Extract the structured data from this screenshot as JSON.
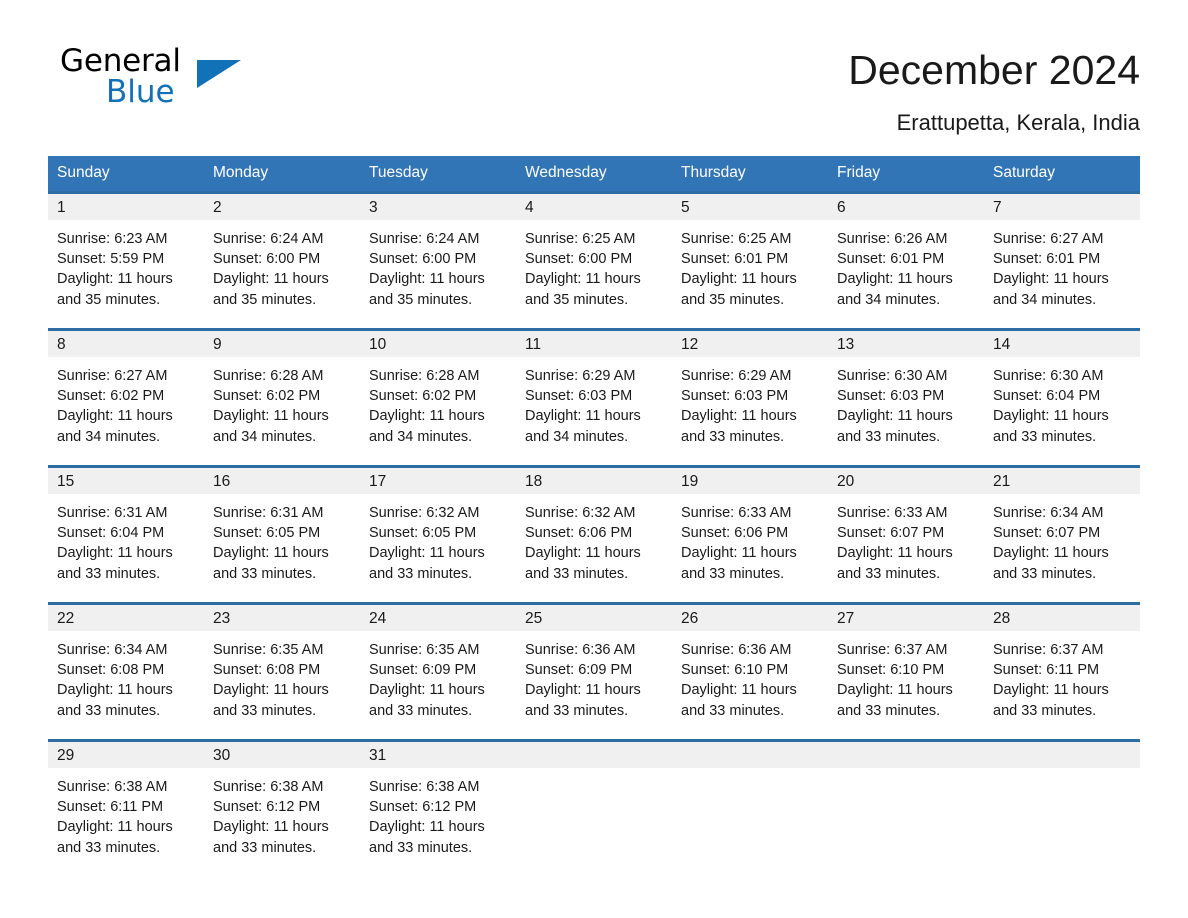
{
  "brand": {
    "line1": "General",
    "line2": "Blue",
    "triangle_color": "#1172b8"
  },
  "header": {
    "title": "December 2024",
    "location": "Erattupetta, Kerala, India"
  },
  "theme": {
    "header_bg": "#3275b6",
    "row_rule": "#2e6da4",
    "daynum_bg": "#f0f0f0",
    "text": "#1a1a1a"
  },
  "weekday_headers": [
    "Sunday",
    "Monday",
    "Tuesday",
    "Wednesday",
    "Thursday",
    "Friday",
    "Saturday"
  ],
  "labels": {
    "sunrise_prefix": "Sunrise:",
    "sunset_prefix": "Sunset:",
    "daylight_prefix": "Daylight:"
  },
  "weeks": [
    [
      {
        "day": "1",
        "sunrise": "Sunrise: 6:23 AM",
        "sunset": "Sunset: 5:59 PM",
        "daylight_line1": "Daylight: 11 hours",
        "daylight_line2": "and 35 minutes."
      },
      {
        "day": "2",
        "sunrise": "Sunrise: 6:24 AM",
        "sunset": "Sunset: 6:00 PM",
        "daylight_line1": "Daylight: 11 hours",
        "daylight_line2": "and 35 minutes."
      },
      {
        "day": "3",
        "sunrise": "Sunrise: 6:24 AM",
        "sunset": "Sunset: 6:00 PM",
        "daylight_line1": "Daylight: 11 hours",
        "daylight_line2": "and 35 minutes."
      },
      {
        "day": "4",
        "sunrise": "Sunrise: 6:25 AM",
        "sunset": "Sunset: 6:00 PM",
        "daylight_line1": "Daylight: 11 hours",
        "daylight_line2": "and 35 minutes."
      },
      {
        "day": "5",
        "sunrise": "Sunrise: 6:25 AM",
        "sunset": "Sunset: 6:01 PM",
        "daylight_line1": "Daylight: 11 hours",
        "daylight_line2": "and 35 minutes."
      },
      {
        "day": "6",
        "sunrise": "Sunrise: 6:26 AM",
        "sunset": "Sunset: 6:01 PM",
        "daylight_line1": "Daylight: 11 hours",
        "daylight_line2": "and 34 minutes."
      },
      {
        "day": "7",
        "sunrise": "Sunrise: 6:27 AM",
        "sunset": "Sunset: 6:01 PM",
        "daylight_line1": "Daylight: 11 hours",
        "daylight_line2": "and 34 minutes."
      }
    ],
    [
      {
        "day": "8",
        "sunrise": "Sunrise: 6:27 AM",
        "sunset": "Sunset: 6:02 PM",
        "daylight_line1": "Daylight: 11 hours",
        "daylight_line2": "and 34 minutes."
      },
      {
        "day": "9",
        "sunrise": "Sunrise: 6:28 AM",
        "sunset": "Sunset: 6:02 PM",
        "daylight_line1": "Daylight: 11 hours",
        "daylight_line2": "and 34 minutes."
      },
      {
        "day": "10",
        "sunrise": "Sunrise: 6:28 AM",
        "sunset": "Sunset: 6:02 PM",
        "daylight_line1": "Daylight: 11 hours",
        "daylight_line2": "and 34 minutes."
      },
      {
        "day": "11",
        "sunrise": "Sunrise: 6:29 AM",
        "sunset": "Sunset: 6:03 PM",
        "daylight_line1": "Daylight: 11 hours",
        "daylight_line2": "and 34 minutes."
      },
      {
        "day": "12",
        "sunrise": "Sunrise: 6:29 AM",
        "sunset": "Sunset: 6:03 PM",
        "daylight_line1": "Daylight: 11 hours",
        "daylight_line2": "and 33 minutes."
      },
      {
        "day": "13",
        "sunrise": "Sunrise: 6:30 AM",
        "sunset": "Sunset: 6:03 PM",
        "daylight_line1": "Daylight: 11 hours",
        "daylight_line2": "and 33 minutes."
      },
      {
        "day": "14",
        "sunrise": "Sunrise: 6:30 AM",
        "sunset": "Sunset: 6:04 PM",
        "daylight_line1": "Daylight: 11 hours",
        "daylight_line2": "and 33 minutes."
      }
    ],
    [
      {
        "day": "15",
        "sunrise": "Sunrise: 6:31 AM",
        "sunset": "Sunset: 6:04 PM",
        "daylight_line1": "Daylight: 11 hours",
        "daylight_line2": "and 33 minutes."
      },
      {
        "day": "16",
        "sunrise": "Sunrise: 6:31 AM",
        "sunset": "Sunset: 6:05 PM",
        "daylight_line1": "Daylight: 11 hours",
        "daylight_line2": "and 33 minutes."
      },
      {
        "day": "17",
        "sunrise": "Sunrise: 6:32 AM",
        "sunset": "Sunset: 6:05 PM",
        "daylight_line1": "Daylight: 11 hours",
        "daylight_line2": "and 33 minutes."
      },
      {
        "day": "18",
        "sunrise": "Sunrise: 6:32 AM",
        "sunset": "Sunset: 6:06 PM",
        "daylight_line1": "Daylight: 11 hours",
        "daylight_line2": "and 33 minutes."
      },
      {
        "day": "19",
        "sunrise": "Sunrise: 6:33 AM",
        "sunset": "Sunset: 6:06 PM",
        "daylight_line1": "Daylight: 11 hours",
        "daylight_line2": "and 33 minutes."
      },
      {
        "day": "20",
        "sunrise": "Sunrise: 6:33 AM",
        "sunset": "Sunset: 6:07 PM",
        "daylight_line1": "Daylight: 11 hours",
        "daylight_line2": "and 33 minutes."
      },
      {
        "day": "21",
        "sunrise": "Sunrise: 6:34 AM",
        "sunset": "Sunset: 6:07 PM",
        "daylight_line1": "Daylight: 11 hours",
        "daylight_line2": "and 33 minutes."
      }
    ],
    [
      {
        "day": "22",
        "sunrise": "Sunrise: 6:34 AM",
        "sunset": "Sunset: 6:08 PM",
        "daylight_line1": "Daylight: 11 hours",
        "daylight_line2": "and 33 minutes."
      },
      {
        "day": "23",
        "sunrise": "Sunrise: 6:35 AM",
        "sunset": "Sunset: 6:08 PM",
        "daylight_line1": "Daylight: 11 hours",
        "daylight_line2": "and 33 minutes."
      },
      {
        "day": "24",
        "sunrise": "Sunrise: 6:35 AM",
        "sunset": "Sunset: 6:09 PM",
        "daylight_line1": "Daylight: 11 hours",
        "daylight_line2": "and 33 minutes."
      },
      {
        "day": "25",
        "sunrise": "Sunrise: 6:36 AM",
        "sunset": "Sunset: 6:09 PM",
        "daylight_line1": "Daylight: 11 hours",
        "daylight_line2": "and 33 minutes."
      },
      {
        "day": "26",
        "sunrise": "Sunrise: 6:36 AM",
        "sunset": "Sunset: 6:10 PM",
        "daylight_line1": "Daylight: 11 hours",
        "daylight_line2": "and 33 minutes."
      },
      {
        "day": "27",
        "sunrise": "Sunrise: 6:37 AM",
        "sunset": "Sunset: 6:10 PM",
        "daylight_line1": "Daylight: 11 hours",
        "daylight_line2": "and 33 minutes."
      },
      {
        "day": "28",
        "sunrise": "Sunrise: 6:37 AM",
        "sunset": "Sunset: 6:11 PM",
        "daylight_line1": "Daylight: 11 hours",
        "daylight_line2": "and 33 minutes."
      }
    ],
    [
      {
        "day": "29",
        "sunrise": "Sunrise: 6:38 AM",
        "sunset": "Sunset: 6:11 PM",
        "daylight_line1": "Daylight: 11 hours",
        "daylight_line2": "and 33 minutes."
      },
      {
        "day": "30",
        "sunrise": "Sunrise: 6:38 AM",
        "sunset": "Sunset: 6:12 PM",
        "daylight_line1": "Daylight: 11 hours",
        "daylight_line2": "and 33 minutes."
      },
      {
        "day": "31",
        "sunrise": "Sunrise: 6:38 AM",
        "sunset": "Sunset: 6:12 PM",
        "daylight_line1": "Daylight: 11 hours",
        "daylight_line2": "and 33 minutes."
      },
      {
        "day": "",
        "sunrise": "",
        "sunset": "",
        "daylight_line1": "",
        "daylight_line2": ""
      },
      {
        "day": "",
        "sunrise": "",
        "sunset": "",
        "daylight_line1": "",
        "daylight_line2": ""
      },
      {
        "day": "",
        "sunrise": "",
        "sunset": "",
        "daylight_line1": "",
        "daylight_line2": ""
      },
      {
        "day": "",
        "sunrise": "",
        "sunset": "",
        "daylight_line1": "",
        "daylight_line2": ""
      }
    ]
  ]
}
